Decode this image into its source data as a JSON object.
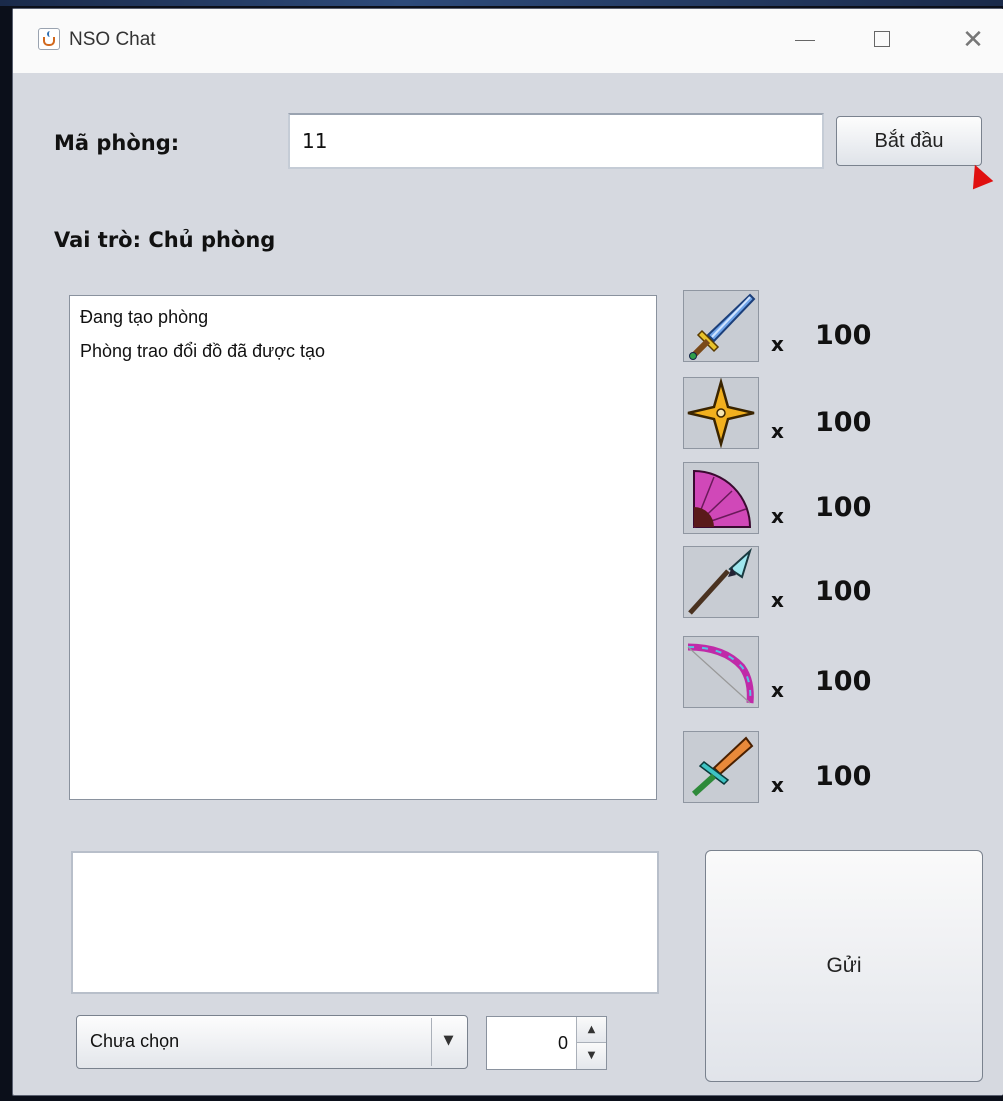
{
  "window": {
    "title": "NSO Chat",
    "minimize_glyph": "",
    "maximize_glyph": "",
    "close_glyph": "✕"
  },
  "room": {
    "label": "Mã phòng:",
    "value": "11",
    "start_button": "Bắt đầu"
  },
  "role": {
    "text": "Vai trò: Chủ phòng"
  },
  "log": {
    "lines": [
      "Đang tạo phòng",
      "Phòng trao đổi đồ đã được tạo"
    ]
  },
  "items": [
    {
      "icon": "sword-icon",
      "x": "x",
      "qty": "100"
    },
    {
      "icon": "shuriken-icon",
      "x": "x",
      "qty": "100"
    },
    {
      "icon": "fan-icon",
      "x": "x",
      "qty": "100"
    },
    {
      "icon": "spear-icon",
      "x": "x",
      "qty": "100"
    },
    {
      "icon": "bow-icon",
      "x": "x",
      "qty": "100"
    },
    {
      "icon": "knife-icon",
      "x": "x",
      "qty": "100"
    }
  ],
  "message": {
    "value": ""
  },
  "send_button": "Gửi",
  "item_select": {
    "selected": "Chưa chọn"
  },
  "quantity_spinner": {
    "value": "0"
  },
  "colors": {
    "window_bg": "#d6d9e0",
    "annotation_arrow": "#e01010"
  }
}
